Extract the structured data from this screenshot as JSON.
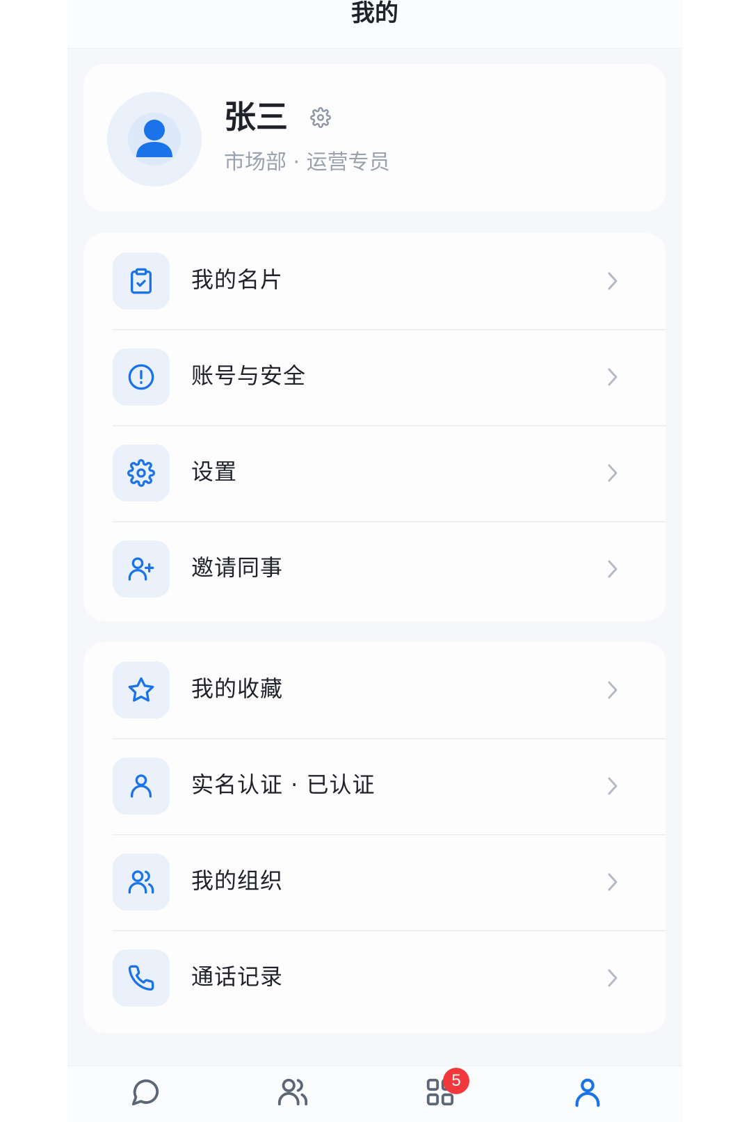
{
  "header": {
    "title": "我的"
  },
  "profile": {
    "name": "张三",
    "dept": "市场部 · 运营专员"
  },
  "colors": {
    "accent": "#1a73e8",
    "text": "#1f2329",
    "muted": "#9aa2ae",
    "badge": "#f0383d"
  },
  "menu_group_1": [
    {
      "label": "我的名片",
      "icon": "clipboard-check-icon"
    },
    {
      "label": "账号与安全",
      "icon": "alert-circle-icon"
    },
    {
      "label": "设置",
      "icon": "gear-icon"
    },
    {
      "label": "邀请同事",
      "icon": "user-plus-icon"
    }
  ],
  "menu_group_2": [
    {
      "label": "我的收藏",
      "icon": "star-icon"
    },
    {
      "label": "实名认证 · 已认证",
      "icon": "user-icon"
    },
    {
      "label": "我的组织",
      "icon": "users-icon"
    },
    {
      "label": "通话记录",
      "icon": "phone-icon"
    }
  ],
  "tabbar": {
    "items": [
      {
        "icon": "chat-bubble-icon"
      },
      {
        "icon": "contacts-icon"
      },
      {
        "icon": "apps-grid-icon",
        "badge": "5"
      },
      {
        "icon": "profile-icon",
        "active": true
      }
    ]
  }
}
